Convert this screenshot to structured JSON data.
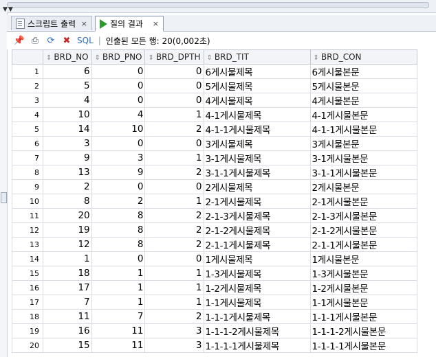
{
  "tabs": [
    {
      "label": "스크립트 출력",
      "close": "×",
      "active": false
    },
    {
      "label": "질의 결과",
      "close": "×",
      "active": true
    }
  ],
  "toolbar": {
    "sql_label": "SQL",
    "separator": "|",
    "status": "인출된 모든 행: 20(0,002초)"
  },
  "grid": {
    "columns": [
      "BRD_NO",
      "BRD_PNO",
      "BRD_DPTH",
      "BRD_TIT",
      "BRD_CON"
    ],
    "rows": [
      [
        "1",
        "6",
        "0",
        "0",
        "6게시물제목",
        "6게시물본문"
      ],
      [
        "2",
        "5",
        "0",
        "0",
        "5게시물제목",
        "5게시물본문"
      ],
      [
        "3",
        "4",
        "0",
        "0",
        "4게시물제목",
        "4게시물본문"
      ],
      [
        "4",
        "10",
        "4",
        "1",
        "4-1게시물제목",
        "4-1게시물본문"
      ],
      [
        "5",
        "14",
        "10",
        "2",
        "4-1-1게시물제목",
        "4-1-1게시물본문"
      ],
      [
        "6",
        "3",
        "0",
        "0",
        "3게시물제목",
        "3게시물본문"
      ],
      [
        "7",
        "9",
        "3",
        "1",
        "3-1게시물제목",
        "3-1게시물본문"
      ],
      [
        "8",
        "13",
        "9",
        "2",
        "3-1-1게시물제목",
        "3-1-1게시물본문"
      ],
      [
        "9",
        "2",
        "0",
        "0",
        "2게시물제목",
        "2게시물본문"
      ],
      [
        "10",
        "8",
        "2",
        "1",
        "2-1게시물제목",
        "2-1게시물본문"
      ],
      [
        "11",
        "20",
        "8",
        "2",
        "2-1-3게시물제목",
        "2-1-3게시물본문"
      ],
      [
        "12",
        "19",
        "8",
        "2",
        "2-1-2게시물제목",
        "2-1-2게시물본문"
      ],
      [
        "13",
        "12",
        "8",
        "2",
        "2-1-1게시물제목",
        "2-1-1게시물본문"
      ],
      [
        "14",
        "1",
        "0",
        "0",
        "1게시물제목",
        "1게시물본문"
      ],
      [
        "15",
        "18",
        "1",
        "1",
        "1-3게시물제목",
        "1-3게시물본문"
      ],
      [
        "16",
        "17",
        "1",
        "1",
        "1-2게시물제목",
        "1-2게시물본문"
      ],
      [
        "17",
        "7",
        "1",
        "1",
        "1-1게시물제목",
        "1-1게시물본문"
      ],
      [
        "18",
        "11",
        "7",
        "2",
        "1-1-1게시물제목",
        "1-1-1게시물본문"
      ],
      [
        "19",
        "16",
        "11",
        "3",
        "1-1-1-2게시물제목",
        "1-1-1-2게시물본문"
      ],
      [
        "20",
        "15",
        "11",
        "3",
        "1-1-1-1게시물제목",
        "1-1-1-1게시물본문"
      ]
    ]
  }
}
